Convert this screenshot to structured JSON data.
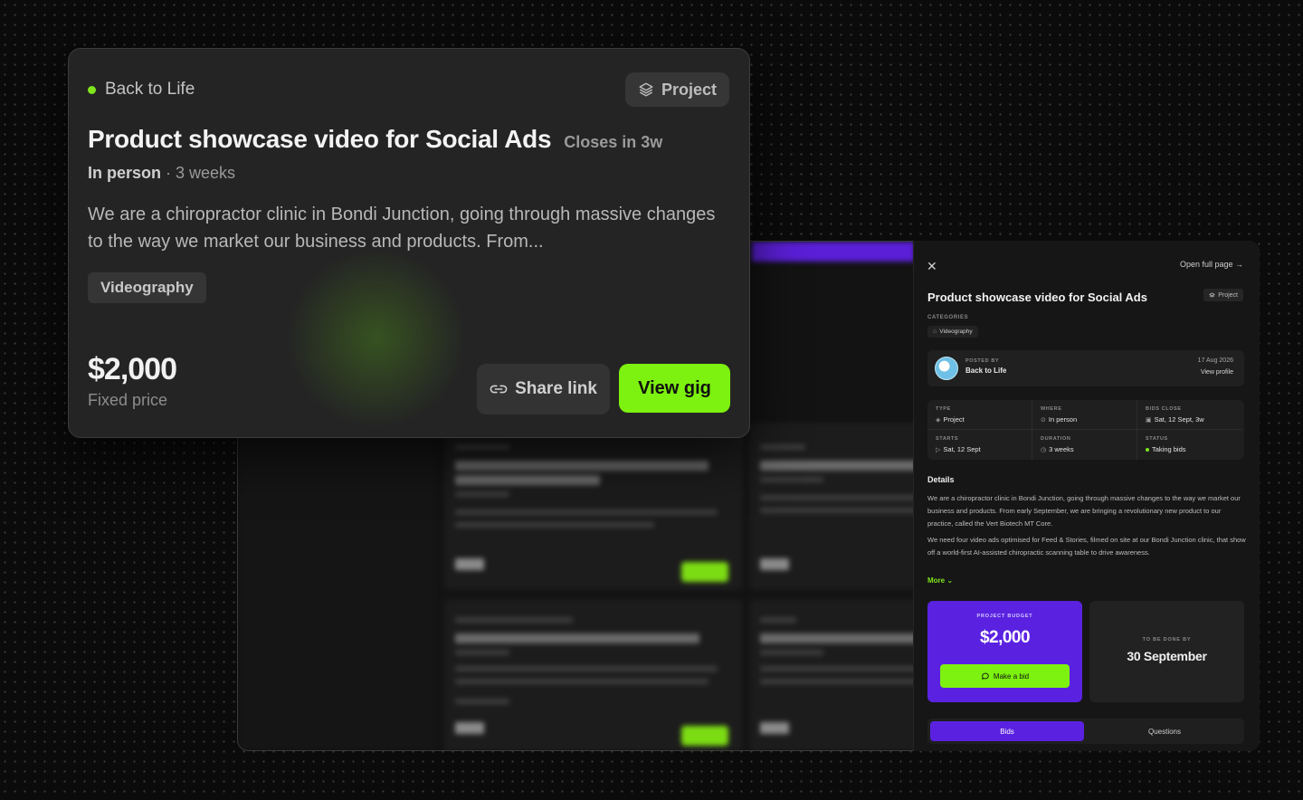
{
  "gig_card": {
    "poster_name": "Back to Life",
    "type_chip": "Project",
    "title": "Product showcase video for Social Ads",
    "closes": "Closes in 3w",
    "location": "In person",
    "duration_text": "· 3 weeks",
    "description": "We are a chiropractor clinic in Bondi Junction, going through massive changes to the way we market our business and products. From...",
    "category_tag": "Videography",
    "price": "$2,000",
    "price_type": "Fixed price",
    "share_label": "Share link",
    "view_label": "View gig",
    "accent_color": "#7df10f"
  },
  "panel": {
    "open_full_page": "Open full page →",
    "title": "Product showcase video for Social Ads",
    "type_chip": "Project",
    "categories_label": "CATEGORIES",
    "category": "Videography",
    "posted_by_label": "POSTED BY",
    "poster_name": "Back to Life",
    "posted_date": "17 Aug 2026",
    "view_profile": "View profile",
    "info": [
      {
        "key": "TYPE",
        "value": "Project",
        "icon": "layers-icon"
      },
      {
        "key": "WHERE",
        "value": "In person",
        "icon": "location-pin-icon"
      },
      {
        "key": "BIDS CLOSE",
        "value": "Sat, 12 Sept, 3w",
        "icon": "calendar-icon"
      },
      {
        "key": "STARTS",
        "value": "Sat, 12 Sept",
        "icon": "play-icon"
      },
      {
        "key": "DURATION",
        "value": "3 weeks",
        "icon": "clock-icon"
      },
      {
        "key": "STATUS",
        "value": "Taking bids",
        "icon": "status-dot-icon"
      }
    ],
    "details_heading": "Details",
    "details_p1": "We are a chiropractor clinic in Bondi Junction, going through massive changes to the way we market our business and products. From early September, we are bringing a revolutionary new product to our practice, called the Vert Biotech MT Core.",
    "details_p2": "We need four video ads optimised for Feed & Stories, filmed on site at our Bondi Junction clinic, that show off a world-first AI-assisted chiropractic scanning table to drive awareness.",
    "more_label": "More",
    "budget_label": "PROJECT BUDGET",
    "budget_amount": "$2,000",
    "bid_button": "Make a bid",
    "done_by_label": "TO BE DONE BY",
    "done_by_value": "30 September",
    "tabs": [
      "Bids",
      "Questions"
    ],
    "brand_purple": "#5a22e0"
  }
}
